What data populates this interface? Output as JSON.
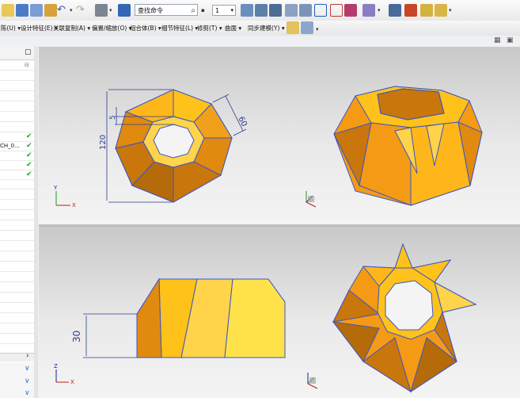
{
  "toolbar": {
    "search_placeholder": "查找命令",
    "number_value": "1",
    "menus": [
      "陈(U) ▾",
      "设计特征(E) ▾",
      "关联复制(A) ▾",
      "偏置/缩放(O) ▾",
      "组合体(B) ▾",
      "细节特征(L) ▾",
      "修剪(T) ▾",
      "曲面 ▾",
      "同步建模(Y) ▾"
    ]
  },
  "navigator": {
    "row_text": "CH_0...",
    "collapse_symbol": "▢",
    "scroll_right": "›"
  },
  "views": {
    "top_left": {
      "dim_height": "120",
      "dim_width": "60",
      "dim_small": "5"
    },
    "bottom_left": {
      "dim_height": "30"
    }
  },
  "colors": {
    "face_light": "#ffc21a",
    "face_mid": "#f59a14",
    "face_dark": "#c9760c",
    "edge": "#3a56c9",
    "dimension": "#2a3b8f"
  }
}
